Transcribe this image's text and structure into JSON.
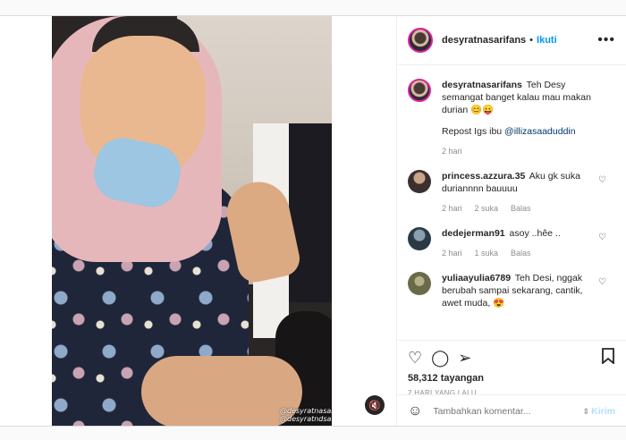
{
  "post": {
    "username": "desyratnasarifans",
    "follow_label": "Ikuti",
    "more_icon": "more-horizontal-icon",
    "watermark": [
      "@desyratnasariterdepan",
      "@desyratndsarifans"
    ],
    "mute_icon": "speaker-muted-icon"
  },
  "caption": {
    "username": "desyratnasarifans",
    "text": "Teh Desy semangat banget kalau mau makan durian 😊😛",
    "repost_prefix": "Repost Igs ibu",
    "repost_mention": "@illizasaaduddin",
    "time": "2 hari"
  },
  "comments": [
    {
      "username": "princess.azzura.35",
      "text": "Aku gk suka duriannnn bauuuu",
      "time": "2 hari",
      "likes": "2 suka",
      "reply": "Balas",
      "avatar_color": "#3a3030"
    },
    {
      "username": "dedejerman91",
      "text": "asoy ..hêe ..",
      "time": "2 hari",
      "likes": "1 suka",
      "reply": "Balas",
      "avatar_color": "#2a3a45"
    },
    {
      "username": "yuliaayulia6789",
      "text": "Teh Desi, nggak berubah sampai sekarang, cantik, awet muda, 😍",
      "avatar_color": "#6a6a4a"
    }
  ],
  "actions": {
    "views": "58,312 tayangan",
    "date": "2 HARI YANG LALU"
  },
  "add_comment": {
    "placeholder": "Tambahkan komentar...",
    "send": "Kirim"
  }
}
